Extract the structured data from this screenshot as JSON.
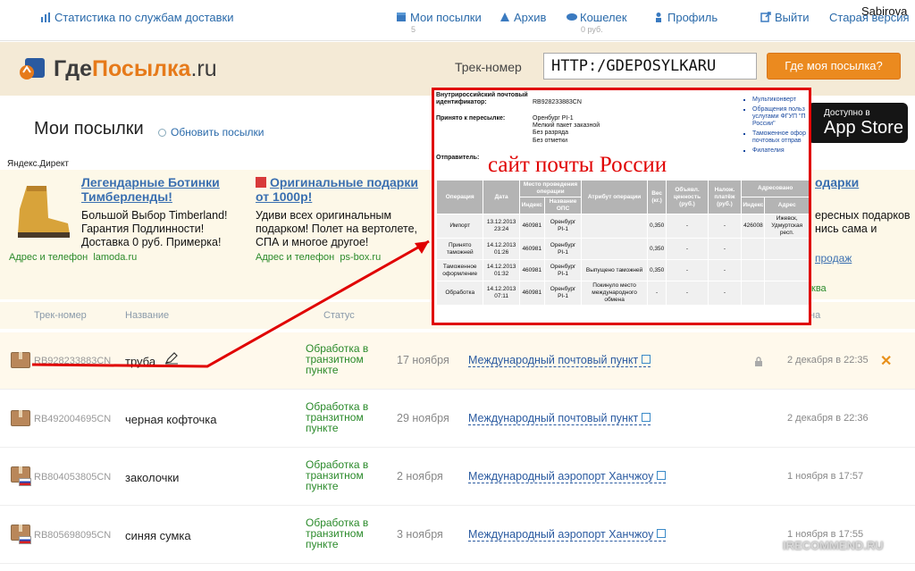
{
  "topbar": {
    "stats_link": "Статистика по службам доставки",
    "my_parcels": "Мои посылки",
    "my_parcels_count": "5",
    "archive": "Архив",
    "wallet": "Кошелек",
    "wallet_amount": "0 руб.",
    "profile": "Профиль",
    "logout": "Выйти",
    "old_version": "Старая версия",
    "username": "Sabirova"
  },
  "header": {
    "logo_part1": "Где",
    "logo_part2": "Посылка",
    "logo_part3": ".ru",
    "track_label": "Трек-номер",
    "track_value": "HTTP:/GDEPOSYLKARU",
    "track_button": "Где моя посылка?"
  },
  "main": {
    "title": "Мои посылки",
    "refresh": "Обновить посылки",
    "appstore_small": "Доступно в",
    "appstore_big": "App Store"
  },
  "ads": {
    "label": "Яндекс.Директ",
    "items": [
      {
        "title": "Легендарные Ботинки Тимберленды!",
        "text": "Большой Выбор Timberland! Гарантия Подлинности! Доставка 0 руб. Примерка!",
        "footer_label": "Адрес и телефон",
        "footer_link": "lamoda.ru"
      },
      {
        "title": "Оригинальные подарки от 1000р!",
        "text": "Удиви всех оригинальным подарком! Полет на вертолете, СПА и многое другое!",
        "footer_label": "Адрес и телефон",
        "footer_link": "ps-box.ru"
      },
      {
        "title": "одарки",
        "text": "ересных подарков нись сама и",
        "footer_link1": "продаж",
        "footer_link2": "ква"
      }
    ]
  },
  "columns": {
    "track": "Трек-номер",
    "name": "Название",
    "status": "Статус",
    "right": "на"
  },
  "parcels": [
    {
      "track": "RB928233883CN",
      "name": "труба",
      "status": "Обработка в транзитном пункте",
      "date": "17 ноября",
      "location": "Международный почтовый пункт",
      "updated": "2 декабря в 22:35"
    },
    {
      "track": "RB492004695CN",
      "name": "черная кофточка",
      "status": "Обработка в транзитном пункте",
      "date": "29 ноября",
      "location": "Международный почтовый пункт",
      "updated": "2 декабря в 22:36"
    },
    {
      "track": "RB804053805CN",
      "name": "заколочки",
      "status": "Обработка в транзитном пункте",
      "date": "2 ноября",
      "location": "Международный аэропорт Ханчжоу",
      "updated": "1 ноября в 17:57"
    },
    {
      "track": "RB805698095CN",
      "name": "синяя сумка",
      "status": "Обработка в транзитном пункте",
      "date": "3 ноября",
      "location": "Международный аэропорт Ханчжоу",
      "updated": "1 ноября в 17:55"
    }
  ],
  "popup": {
    "id_label": "Внутрироссийский почтовый идентификатор:",
    "id_value": "RB928233883CN",
    "accepted_label": "Принято к пересылке:",
    "accepted_lines": [
      "Оренбург PI-1",
      "Мелкий пакет заказной",
      "Без разряда",
      "Без отметки"
    ],
    "sender_label": "Отправитель:",
    "annotation": "сайт почты России",
    "links": [
      "Мультиконверт",
      "Обращения польз услугами ФГУП \"П России\"",
      "Таможенное офор почтовых отправ",
      "Филателия"
    ],
    "table_headers": {
      "op": "Операция",
      "date": "Дата",
      "place": "Место проведения операции",
      "index": "Индекс",
      "ops": "Название ОПС",
      "attr": "Атрибут операции",
      "weight": "Вес (кг.)",
      "declared": "Объявл. ценность (руб.)",
      "cod": "Налож. платёж (руб.)",
      "addressed": "Адресовано",
      "aindex": "Индекс",
      "addr": "Адрес"
    },
    "rows": [
      {
        "op": "Импорт",
        "date": "13.12.2013 23:24",
        "index": "460981",
        "ops": "Оренбург PI-1",
        "attr": "",
        "weight": "0,350",
        "declared": "-",
        "cod": "-",
        "aindex": "426008",
        "addr": "Ижевск, Удмуртская респ."
      },
      {
        "op": "Принято таможней",
        "date": "14.12.2013 01:26",
        "index": "460981",
        "ops": "Оренбург PI-1",
        "attr": "",
        "weight": "0,350",
        "declared": "-",
        "cod": "-",
        "aindex": "",
        "addr": ""
      },
      {
        "op": "Таможенное оформление",
        "date": "14.12.2013 01:32",
        "index": "460981",
        "ops": "Оренбург PI-1",
        "attr": "Выпущено таможней",
        "weight": "0,350",
        "declared": "-",
        "cod": "-",
        "aindex": "",
        "addr": ""
      },
      {
        "op": "Обработка",
        "date": "14.12.2013 07:11",
        "index": "460981",
        "ops": "Оренбург PI-1",
        "attr": "Покинуло место международного обмена",
        "weight": "-",
        "declared": "-",
        "cod": "-",
        "aindex": "",
        "addr": ""
      }
    ]
  },
  "watermark": "IRECOMMEND.RU",
  "colors": {
    "orange": "#eb8a1f",
    "link_blue": "#2a6aaa",
    "status_green": "#2a8a2a",
    "annotation_red": "#e00000"
  }
}
